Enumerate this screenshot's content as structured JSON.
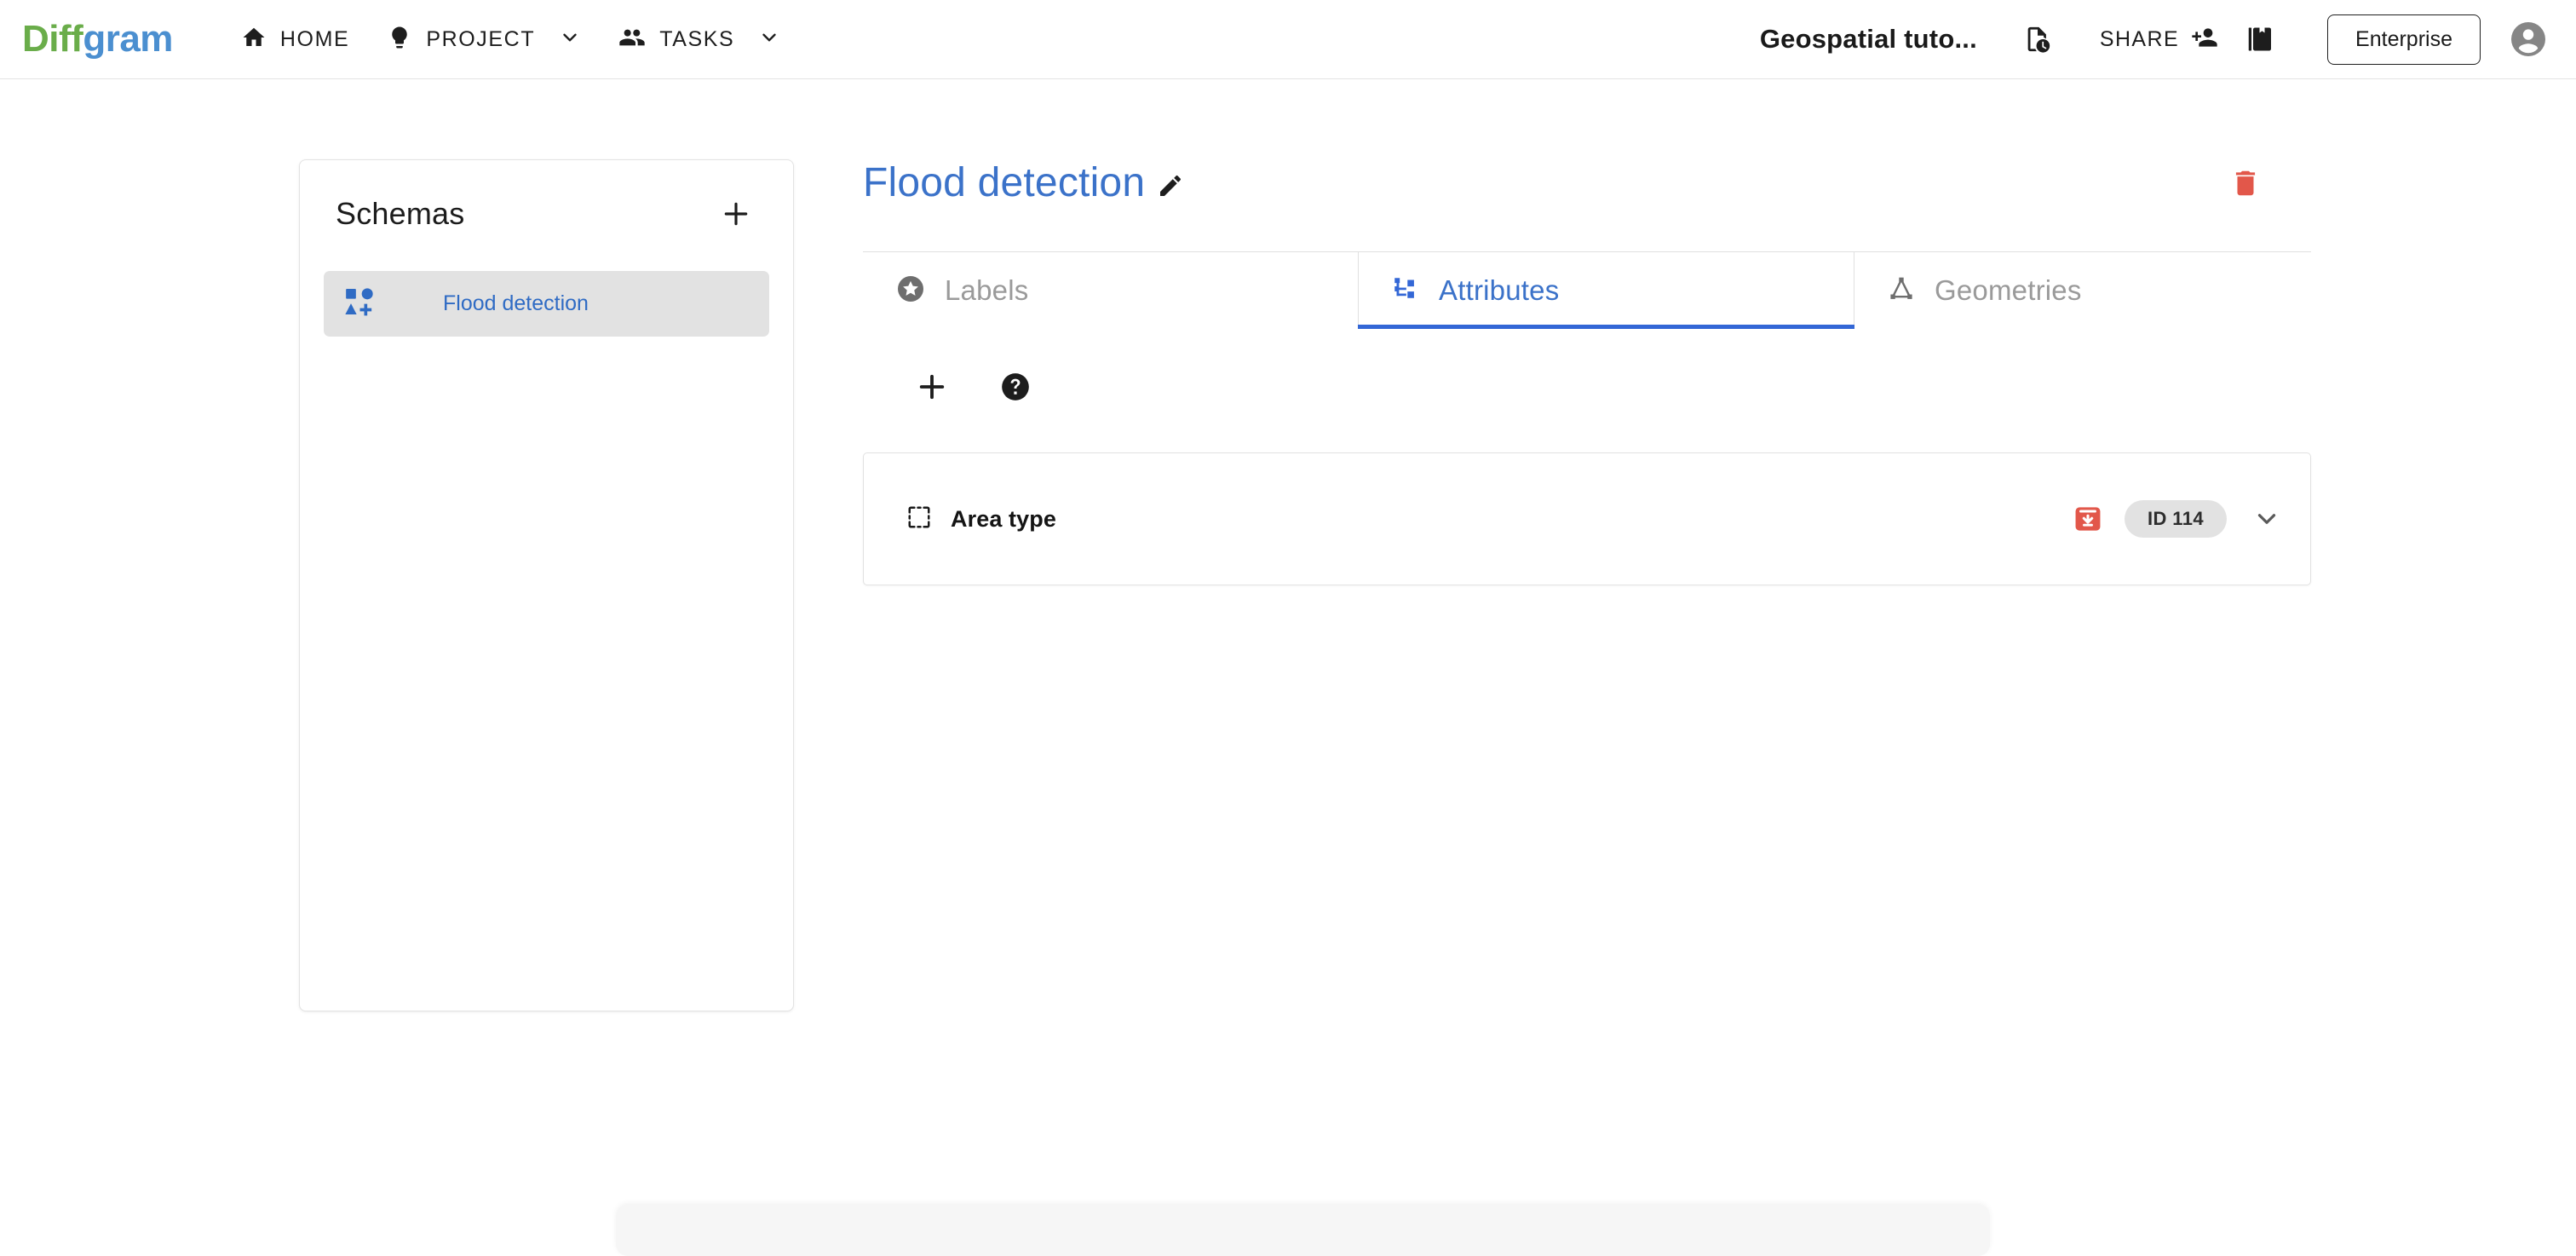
{
  "topnav": {
    "logo": {
      "part1": "Diff",
      "part2": "gram",
      "color1": "#6aad4a",
      "color2": "#4b8fd0"
    },
    "items": [
      {
        "label": "HOME",
        "icon": "home-icon",
        "has_chevron": false
      },
      {
        "label": "PROJECT",
        "icon": "lightbulb-icon",
        "has_chevron": true
      },
      {
        "label": "TASKS",
        "icon": "people-icon",
        "has_chevron": true
      }
    ],
    "document_title": "Geospatial tuto...",
    "file_history_icon": "file-clock-icon",
    "share_label": "SHARE",
    "share_icon": "person-add-icon",
    "bookmark_icon": "bookmark-icon",
    "enterprise_label": "Enterprise",
    "avatar_icon": "account-circle-icon"
  },
  "sidebar": {
    "title": "Schemas",
    "add_icon": "plus-icon",
    "items": [
      {
        "label": "Flood detection",
        "icon": "schema-shapes-icon",
        "selected": true
      }
    ]
  },
  "main": {
    "title": "Flood detection",
    "edit_icon": "pencil-icon",
    "delete_icon": "trash-icon",
    "accent_color": "#3367d6",
    "danger_color": "#e2574a",
    "tabs": [
      {
        "label": "Labels",
        "icon": "star-circle-icon",
        "active": false
      },
      {
        "label": "Attributes",
        "icon": "account-tree-icon",
        "active": true
      },
      {
        "label": "Geometries",
        "icon": "polygon-nodes-icon",
        "active": false
      }
    ],
    "toolbar": [
      {
        "icon": "plus-icon",
        "name": "add-attribute-button"
      },
      {
        "icon": "help-circle-icon",
        "name": "help-button"
      }
    ],
    "attributes": [
      {
        "name": "Area type",
        "icon": "dashed-square-icon",
        "archive_icon": "archive-download-icon",
        "id_badge": "ID 114",
        "expand_icon": "chevron-down-icon"
      }
    ]
  }
}
